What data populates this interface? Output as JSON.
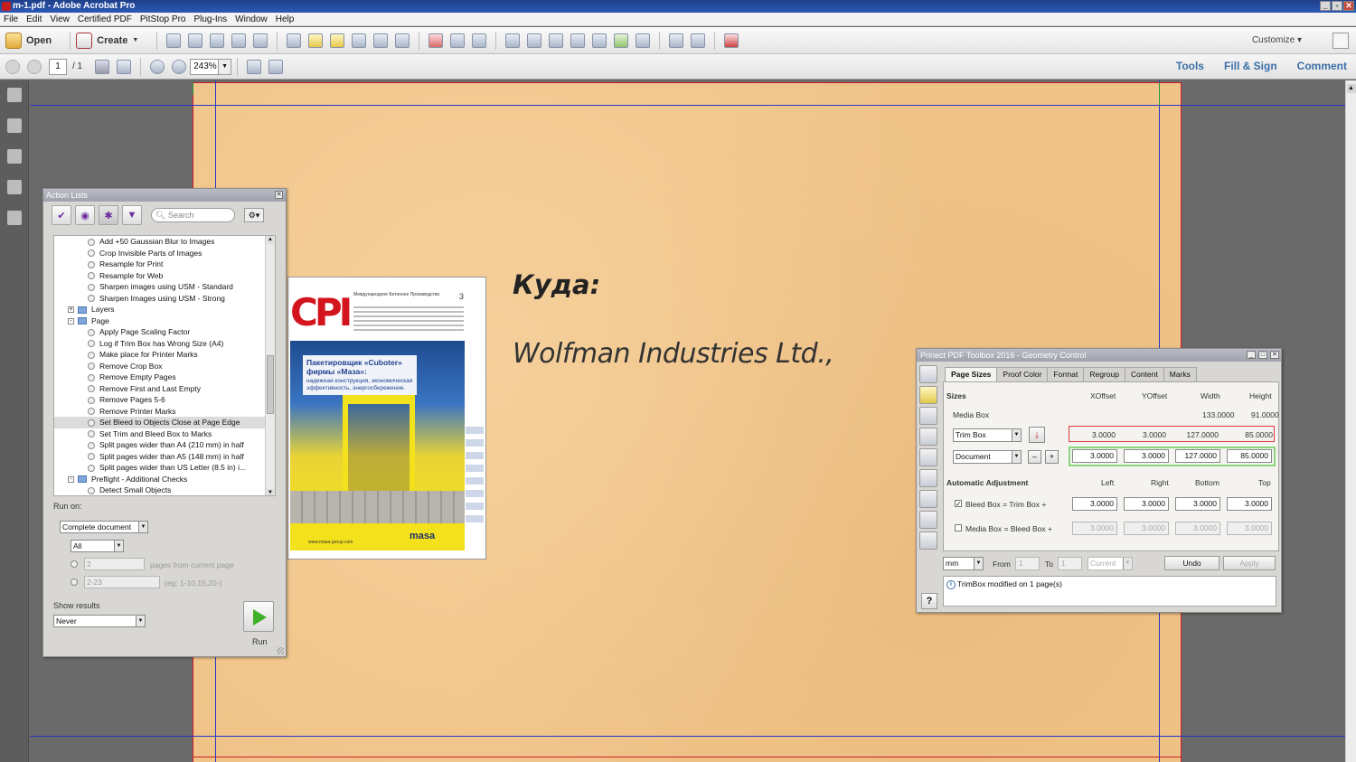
{
  "window": {
    "title": "m-1.pdf - Adobe Acrobat Pro",
    "controls": [
      "_",
      "▫",
      "✕"
    ]
  },
  "menu": [
    "File",
    "Edit",
    "View",
    "Certified PDF",
    "PitStop Pro",
    "Plug-Ins",
    "Window",
    "Help"
  ],
  "toolbar": {
    "open_label": "Open",
    "create_label": "Create",
    "customize_label": "Customize"
  },
  "nav": {
    "page_current": "1",
    "page_total": "/ 1",
    "zoom": "243%",
    "tools_label": "Tools",
    "fill_sign_label": "Fill & Sign",
    "comment_label": "Comment"
  },
  "document": {
    "dest_label": "Куда:",
    "dest_name": "Wolfman Industries Ltd.,"
  },
  "cover": {
    "logo": "CPI",
    "header": "Международное Бетонное Производство",
    "issue": "3",
    "headline": "Пакетировщик «Cuboter» фирмы «Маза»:",
    "subline": "надежная конструкция, экономическая эффективность, энергосбережение.",
    "url": "www.masa-group.com",
    "brand": "masa"
  },
  "action_lists": {
    "title": "Action Lists",
    "search_placeholder": "Search",
    "tree": [
      {
        "label": "Add +50 Gaussian Blur to Images",
        "kind": "item",
        "indent": 3
      },
      {
        "label": "Crop Invisible Parts of Images",
        "kind": "item",
        "indent": 3
      },
      {
        "label": "Resample for Print",
        "kind": "item",
        "indent": 3
      },
      {
        "label": "Resample for Web",
        "kind": "item",
        "indent": 3
      },
      {
        "label": "Sharpen images using USM - Standard",
        "kind": "item",
        "indent": 3
      },
      {
        "label": "Sharpen Images using USM - Strong",
        "kind": "item",
        "indent": 3
      },
      {
        "label": "Layers",
        "kind": "folder",
        "toggle": "+",
        "indent": 1
      },
      {
        "label": "Page",
        "kind": "folder",
        "toggle": "-",
        "indent": 1
      },
      {
        "label": "Apply Page Scaling Factor",
        "kind": "item",
        "indent": 3
      },
      {
        "label": "Log if Trim Box has Wrong Size (A4)",
        "kind": "item",
        "indent": 3
      },
      {
        "label": "Make place for Printer Marks",
        "kind": "item",
        "indent": 3
      },
      {
        "label": "Remove Crop Box",
        "kind": "item",
        "indent": 3
      },
      {
        "label": "Remove Empty Pages",
        "kind": "item",
        "indent": 3
      },
      {
        "label": "Remove First and Last Empty",
        "kind": "item",
        "indent": 3
      },
      {
        "label": "Remove Pages 5-6",
        "kind": "item",
        "indent": 3
      },
      {
        "label": "Remove Printer Marks",
        "kind": "item",
        "indent": 3
      },
      {
        "label": "Set Bleed to Objects Close at Page Edge",
        "kind": "item",
        "indent": 3,
        "selected": true
      },
      {
        "label": "Set Trim and Bleed Box to Marks",
        "kind": "item",
        "indent": 3
      },
      {
        "label": "Split pages wider than A4 (210 mm) in half",
        "kind": "item",
        "indent": 3
      },
      {
        "label": "Split pages wider than A5 (148 mm) in half",
        "kind": "item",
        "indent": 3
      },
      {
        "label": "Split pages wider than US Letter (8.5 in) i...",
        "kind": "item",
        "indent": 3
      },
      {
        "label": "Preflight - Additional Checks",
        "kind": "folder",
        "toggle": "-",
        "indent": 1
      },
      {
        "label": "Detect Small Objects",
        "kind": "item",
        "indent": 3
      }
    ],
    "run_on_label": "Run on:",
    "run_on_value": "Complete document",
    "pages_value": "All",
    "pages_count": "2",
    "pages_from_label": "pages from current page",
    "range_value": "2-23",
    "range_hint": "(eg: 1-10,15,20-)",
    "show_results_label": "Show results",
    "show_results_value": "Never",
    "run_label": "Run"
  },
  "geometry": {
    "title": "Prinect PDF Toolbox 2016 - Geometry Control",
    "tabs": [
      "Page Sizes",
      "Proof Color",
      "Format",
      "Regroup",
      "Content",
      "Marks"
    ],
    "sizes_label": "Sizes",
    "col_headers": [
      "XOffset",
      "YOffset",
      "Width",
      "Height"
    ],
    "media_box_label": "Media Box",
    "media_box_width": "133.0000",
    "media_box_height": "91.0000",
    "trim_select": "Trim Box",
    "trim_values": [
      "3.0000",
      "3.0000",
      "127.0000",
      "85.0000"
    ],
    "doc_select": "Document",
    "doc_values": [
      "3.0000",
      "3.0000",
      "127.0000",
      "85.0000"
    ],
    "auto_adj_label": "Automatic Adjustment",
    "adj_headers": [
      "Left",
      "Right",
      "Bottom",
      "Top"
    ],
    "bleed_row_label": "Bleed Box = Trim Box +",
    "bleed_values": [
      "3.0000",
      "3.0000",
      "3.0000",
      "3.0000"
    ],
    "media_row_label": "Media Box = Bleed Box +",
    "media_values": [
      "3.0000",
      "3.0000",
      "3.0000",
      "3.0000"
    ],
    "unit_value": "mm",
    "from_label": "From",
    "from_value": "1",
    "to_label": "To",
    "to_value": "1",
    "current_value": "Current",
    "undo_label": "Undo",
    "apply_label": "Apply",
    "status": "TrimBox modified on 1 page(s)",
    "help_label": "?"
  }
}
